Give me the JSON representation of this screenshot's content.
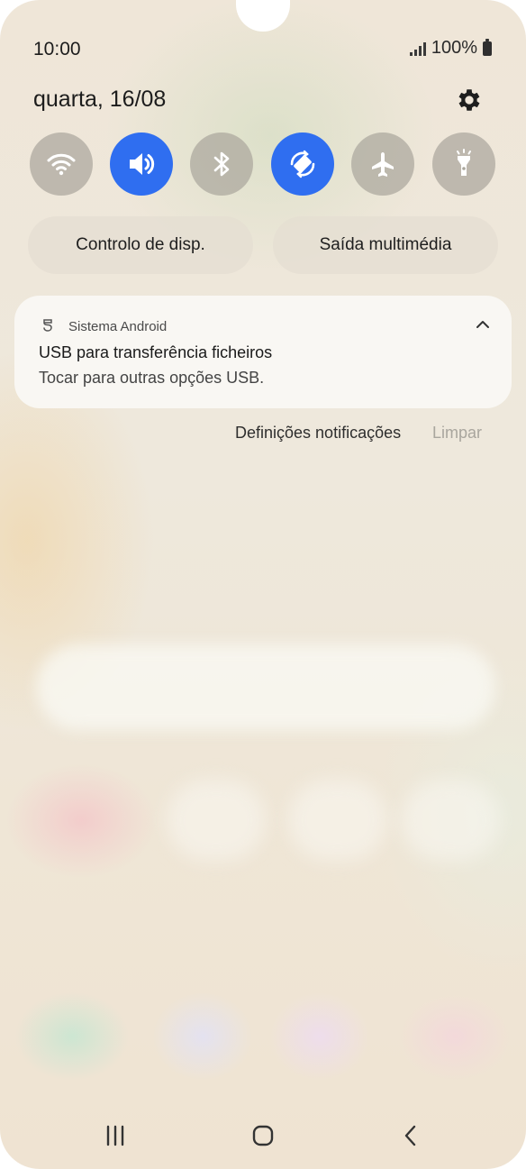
{
  "status_bar": {
    "time": "10:00",
    "battery_percent": "100%",
    "icons": [
      "signal-icon",
      "battery-icon"
    ]
  },
  "header": {
    "date": "quarta, 16/08",
    "settings_icon": "gear-icon"
  },
  "quick_settings": [
    {
      "name": "wifi",
      "icon": "wifi-icon",
      "active": false
    },
    {
      "name": "sound",
      "icon": "volume-icon",
      "active": true
    },
    {
      "name": "bluetooth",
      "icon": "bluetooth-icon",
      "active": false
    },
    {
      "name": "auto-rotate",
      "icon": "rotate-icon",
      "active": true
    },
    {
      "name": "airplane-mode",
      "icon": "airplane-icon",
      "active": false
    },
    {
      "name": "flashlight",
      "icon": "flashlight-icon",
      "active": false
    }
  ],
  "pills": {
    "device_control": "Controlo de disp.",
    "media_output": "Saída multimédia"
  },
  "notification": {
    "app_name": "Sistema Android",
    "title": "USB para transferência ficheiros",
    "text": "Tocar para outras opções USB."
  },
  "notification_actions": {
    "settings": "Definições notificações",
    "clear": "Limpar"
  },
  "navigation": {
    "icons": [
      "recents-icon",
      "home-icon",
      "back-icon"
    ]
  },
  "colors": {
    "accent": "#2f6ef0",
    "tile_inactive": "#aaa69c",
    "card": "#f9f8f4"
  }
}
